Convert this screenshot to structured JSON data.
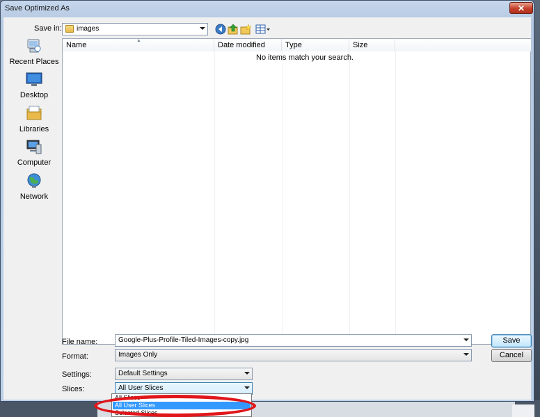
{
  "window": {
    "title": "Save Optimized As",
    "close_label": "✕"
  },
  "save_in": {
    "label": "Save in:",
    "value": "images"
  },
  "toolbar": {
    "icons": [
      "back-icon",
      "up-folder-icon",
      "new-folder-icon",
      "view-menu-icon"
    ]
  },
  "places": [
    {
      "label": "Recent Places",
      "icon": "recent-places-icon"
    },
    {
      "label": "Desktop",
      "icon": "desktop-icon"
    },
    {
      "label": "Libraries",
      "icon": "libraries-icon"
    },
    {
      "label": "Computer",
      "icon": "computer-icon"
    },
    {
      "label": "Network",
      "icon": "network-icon"
    }
  ],
  "file_list": {
    "columns": [
      "Name",
      "Date modified",
      "Type",
      "Size"
    ],
    "empty_message": "No items match your search."
  },
  "form": {
    "file_name_label": "File name:",
    "file_name_value": "Google-Plus-Profile-Tiled-Images-copy.jpg",
    "format_label": "Format:",
    "format_value": "Images Only",
    "settings_label": "Settings:",
    "settings_value": "Default Settings",
    "slices_label": "Slices:",
    "slices_value": "All User Slices"
  },
  "buttons": {
    "save": "Save",
    "cancel": "Cancel"
  },
  "slices_dropdown": {
    "options": [
      "All Slices",
      "All User Slices",
      "Selected Slices"
    ],
    "selected_index": 1
  },
  "colors": {
    "highlight_ring": "#e0161a",
    "selection": "#3399ff"
  }
}
